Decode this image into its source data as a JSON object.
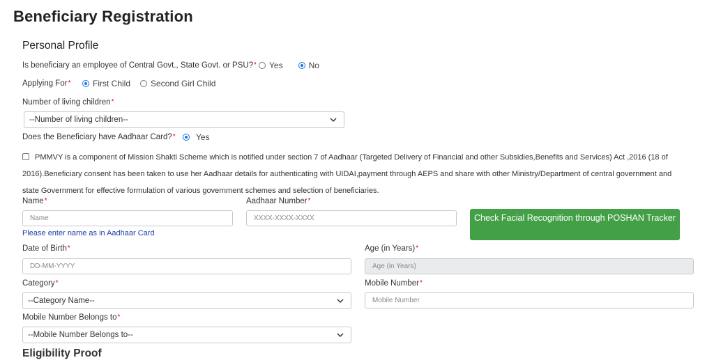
{
  "page": {
    "title": "Beneficiary Registration"
  },
  "sections": {
    "personal_profile": "Personal Profile",
    "eligibility_proof": "Eligibility Proof"
  },
  "employee_question": {
    "label": "Is beneficiary an employee of Central Govt., State Govt. or PSU?",
    "required_mark": "*",
    "options": [
      {
        "label": "Yes",
        "selected": false
      },
      {
        "label": "No",
        "selected": true
      }
    ]
  },
  "applying_for": {
    "label": "Applying For",
    "required_mark": "*",
    "options": [
      {
        "label": "First Child",
        "selected": true
      },
      {
        "label": "Second Girl Child",
        "selected": false
      }
    ]
  },
  "living_children": {
    "label": "Number of living children",
    "required_mark": "*",
    "value": "--Number of living children--"
  },
  "aadhaar_card": {
    "label": "Does the Beneficiary have Aadhaar Card?",
    "required_mark": "*",
    "option": "Yes"
  },
  "consent": {
    "checked": false,
    "text": "PMMVY is a component of Mission Shakti Scheme which is notified under section 7 of Aadhaar (Targeted Delivery of Financial and other Subsidies,Benefits and Services) Act ,2016 (18 of 2016).Beneficiary consent has been taken to use her Aadhaar details for authenticating with UIDAI,payment through AEPS and share with other Ministry/Department of central government and state Government for effective formulation of various government schemes and selection of beneficiaries."
  },
  "name": {
    "label": "Name",
    "required_mark": "*",
    "placeholder": "Name",
    "hint": "Please enter name as in Aadhaar Card"
  },
  "aadhaar_number": {
    "label": "Aadhaar Number",
    "required_mark": "*",
    "placeholder": "XXXX-XXXX-XXXX"
  },
  "facial_button": {
    "label": "Check Facial Recognition through POSHAN Tracker",
    "color": "#43a047"
  },
  "dob": {
    "label": "Date of Birth",
    "required_mark": "*",
    "placeholder": "DD-MM-YYYY"
  },
  "age": {
    "label": "Age (in Years)",
    "required_mark": "*",
    "placeholder": "Age (in Years)"
  },
  "category": {
    "label": "Category",
    "required_mark": "*",
    "value": "--Category Name--"
  },
  "mobile_number": {
    "label": "Mobile Number",
    "required_mark": "*",
    "placeholder": "Mobile Number"
  },
  "mobile_belongs": {
    "label": "Mobile Number Belongs to",
    "required_mark": "*",
    "value": "--Mobile Number Belongs to--"
  },
  "icons": {
    "dropdown": "chevron-down-icon",
    "radio": "radio-icon",
    "checkbox": "checkbox-icon"
  }
}
